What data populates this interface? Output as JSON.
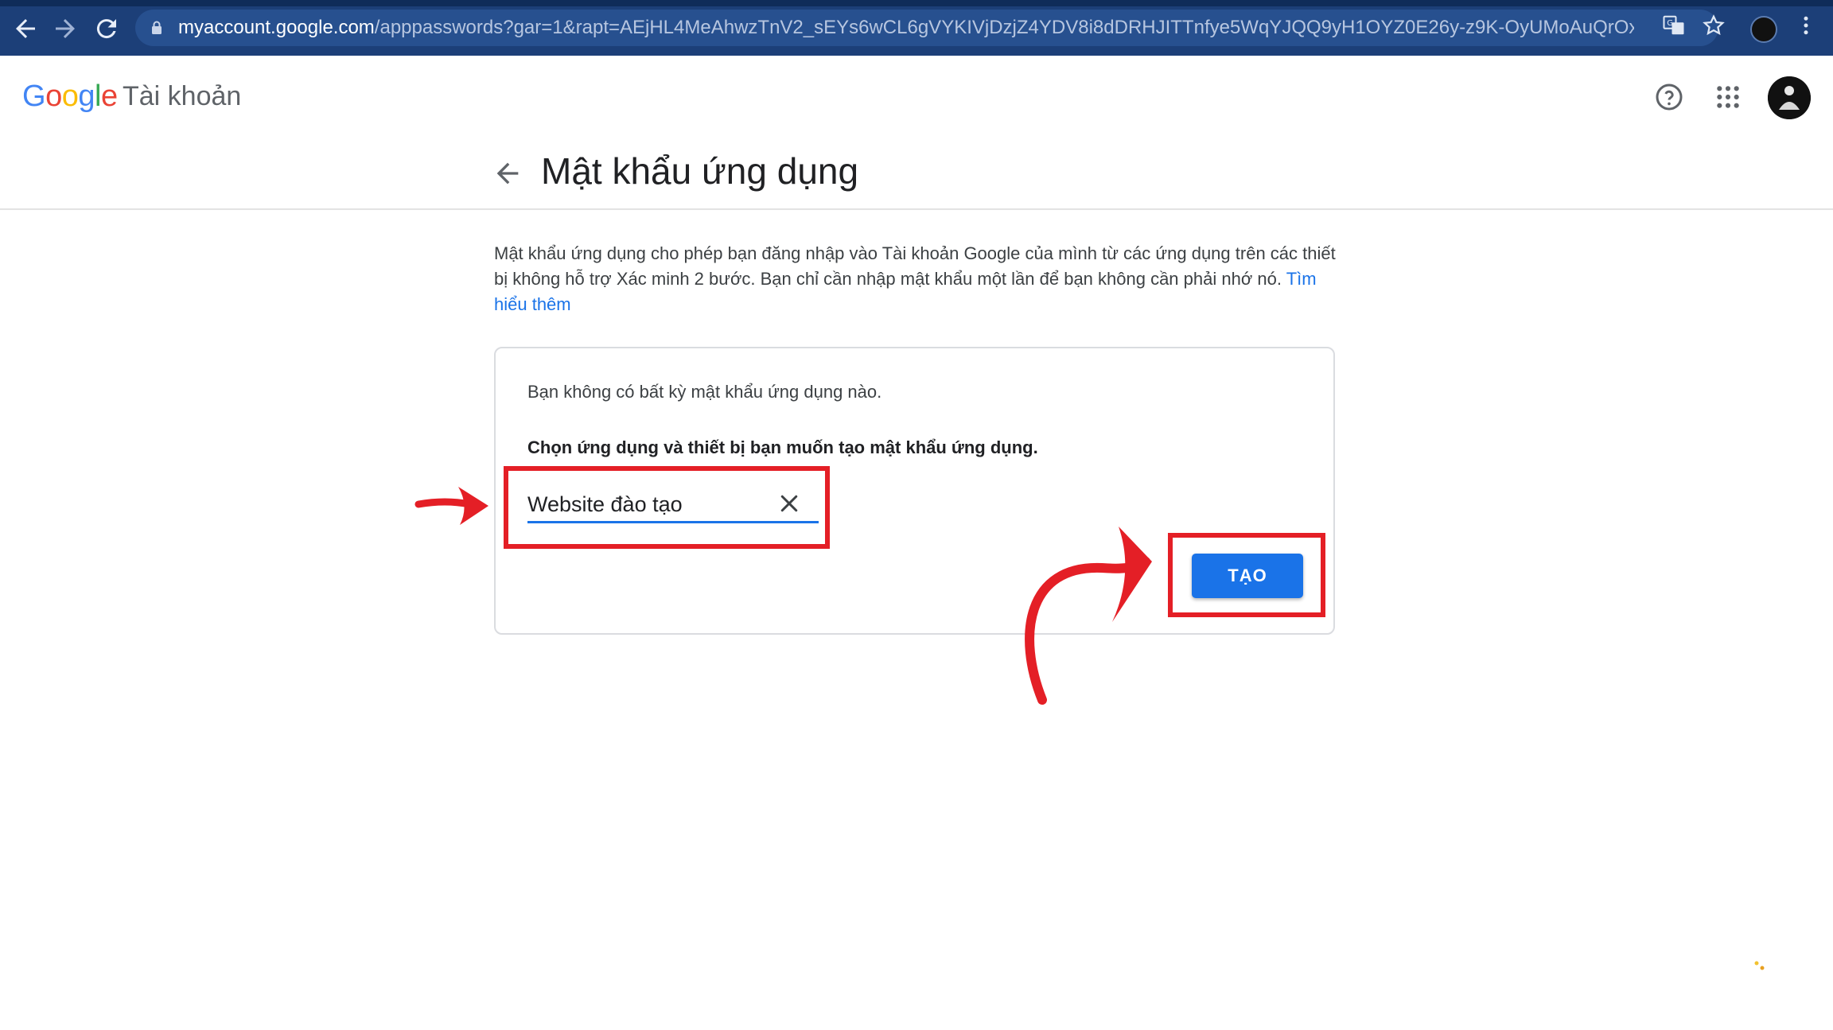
{
  "browser": {
    "url_domain": "myaccount.google.com",
    "url_path": "/apppasswords?gar=1&rapt=AEjHL4MeAhwzTnV2_sEYs6wCL6gVYKIVjDzjZ4YDV8i8dDRHJITTnfye5WqYJQQ9yH1OYZ0E26y-z9K-OyUMoAuQrOxL20...",
    "icons": [
      "back-arrow-icon",
      "forward-arrow-icon",
      "reload-icon",
      "lock-icon",
      "translate-icon",
      "star-icon",
      "profile-avatar",
      "kebab-menu-icon"
    ]
  },
  "header": {
    "logo_letters": [
      "G",
      "o",
      "o",
      "g",
      "l",
      "e"
    ],
    "logo_colors": [
      "#4285F4",
      "#EA4335",
      "#FBBC05",
      "#4285F4",
      "#34A853",
      "#EA4335"
    ],
    "brand_label": "Tài khoản"
  },
  "page": {
    "title": "Mật khẩu ứng dụng",
    "description": "Mật khẩu ứng dụng cho phép bạn đăng nhập vào Tài khoản Google của mình từ các ứng dụng trên các thiết bị không hỗ trợ Xác minh 2 bước. Bạn chỉ cần nhập mật khẩu một lần để bạn không cần phải nhớ nó.",
    "learn_more": "Tìm hiểu thêm"
  },
  "card": {
    "empty_message": "Bạn không có bất kỳ mật khẩu ứng dụng nào.",
    "prompt": "Chọn ứng dụng và thiết bị bạn muốn tạo mật khẩu ứng dụng.",
    "input_value": "Website đào tạo",
    "create_label": "TẠO"
  },
  "colors": {
    "accent": "#1a73e8",
    "annotation": "#e41f26",
    "browser_bar": "#1c3f78"
  }
}
